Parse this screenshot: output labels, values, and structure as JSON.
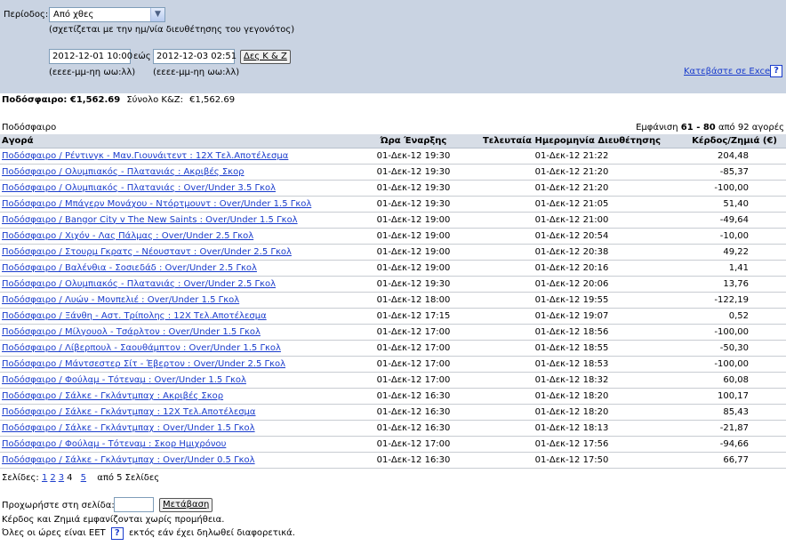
{
  "filters": {
    "period_label": "Περίοδος:",
    "period_value": "Από χθες",
    "period_note": "(σχετίζεται με την ημ/νία διευθέτησης του γεγονότος)",
    "from_value": "2012-12-01 10:00",
    "to_label": "εώς",
    "to_value": "2012-12-03 02:51",
    "show_button": "Δες Κ & Ζ",
    "format_hint_from": "(εεεε-μμ-ηη ωω:λλ)",
    "format_hint_to": "(εεεε-μμ-ηη ωω:λλ)",
    "excel_link": "Κατεβάστε σε Excel",
    "help": "?"
  },
  "totals": {
    "sport_label": "Ποδόσφαιρο: €1,562.69",
    "total_label": "Σύνολο Κ&Ζ:",
    "total_value": "€1,562.69"
  },
  "section_label": "Ποδόσφαιρο",
  "showing": {
    "prefix": "Εμφάνιση",
    "range": "61 - 80",
    "suffix": "από 92 αγορές"
  },
  "columns": [
    "Αγορά",
    "Ώρα Έναρξης",
    "Τελευταία Ημερομηνία Διευθέτησης",
    "Κέρδος/Ζημιά (€)"
  ],
  "rows": [
    {
      "market": "Ποδόσφαιρο / Ρέντινγκ - Μαν.Γιουνάιτεντ : 12X Τελ.Αποτέλεσμα",
      "start": "01-Δεκ-12 19:30",
      "settled": "01-Δεκ-12 21:22",
      "pl": "204,48"
    },
    {
      "market": "Ποδόσφαιρο / Ολυμπιακός - Πλατανιάς : Ακριβές Σκορ",
      "start": "01-Δεκ-12 19:30",
      "settled": "01-Δεκ-12 21:20",
      "pl": "-85,37"
    },
    {
      "market": "Ποδόσφαιρο / Ολυμπιακός - Πλατανιάς : Over/Under 3.5 Γκολ",
      "start": "01-Δεκ-12 19:30",
      "settled": "01-Δεκ-12 21:20",
      "pl": "-100,00"
    },
    {
      "market": "Ποδόσφαιρο / Μπάγερν Μονάχου - Ντόρτμουντ : Over/Under 1.5 Γκολ",
      "start": "01-Δεκ-12 19:30",
      "settled": "01-Δεκ-12 21:05",
      "pl": "51,40"
    },
    {
      "market": "Ποδόσφαιρο / Bangor City v The New Saints : Over/Under 1.5 Γκολ",
      "start": "01-Δεκ-12 19:00",
      "settled": "01-Δεκ-12 21:00",
      "pl": "-49,64"
    },
    {
      "market": "Ποδόσφαιρο / Χιχόν - Λας Πάλμας : Over/Under 2.5 Γκολ",
      "start": "01-Δεκ-12 19:00",
      "settled": "01-Δεκ-12 20:54",
      "pl": "-10,00"
    },
    {
      "market": "Ποδόσφαιρο / Στουρμ Γκρατς - Νέουσταντ : Over/Under 2.5 Γκολ",
      "start": "01-Δεκ-12 19:00",
      "settled": "01-Δεκ-12 20:38",
      "pl": "49,22"
    },
    {
      "market": "Ποδόσφαιρο / Βαλένθια - Σοσιεδάδ : Over/Under 2.5 Γκολ",
      "start": "01-Δεκ-12 19:00",
      "settled": "01-Δεκ-12 20:16",
      "pl": "1,41"
    },
    {
      "market": "Ποδόσφαιρο / Ολυμπιακός - Πλατανιάς : Over/Under 2.5 Γκολ",
      "start": "01-Δεκ-12 19:30",
      "settled": "01-Δεκ-12 20:06",
      "pl": "13,76"
    },
    {
      "market": "Ποδόσφαιρο / Λυών - Μονπελιέ : Over/Under 1.5 Γκολ",
      "start": "01-Δεκ-12 18:00",
      "settled": "01-Δεκ-12 19:55",
      "pl": "-122,19"
    },
    {
      "market": "Ποδόσφαιρο / Ξάνθη - Αστ. Τρίπολης : 12X Τελ.Αποτέλεσμα",
      "start": "01-Δεκ-12 17:15",
      "settled": "01-Δεκ-12 19:07",
      "pl": "0,52"
    },
    {
      "market": "Ποδόσφαιρο / Μίλγουολ - Τσάρλτον : Over/Under 1.5 Γκολ",
      "start": "01-Δεκ-12 17:00",
      "settled": "01-Δεκ-12 18:56",
      "pl": "-100,00"
    },
    {
      "market": "Ποδόσφαιρο / Λίβερπουλ - Σαουθάμπτον : Over/Under 1.5 Γκολ",
      "start": "01-Δεκ-12 17:00",
      "settled": "01-Δεκ-12 18:55",
      "pl": "-50,30"
    },
    {
      "market": "Ποδόσφαιρο / Μάντσεστερ Σίτ - Έβερτον : Over/Under 2.5 Γκολ",
      "start": "01-Δεκ-12 17:00",
      "settled": "01-Δεκ-12 18:53",
      "pl": "-100,00"
    },
    {
      "market": "Ποδόσφαιρο / Φούλαμ - Τότεναμ : Over/Under 1.5 Γκολ",
      "start": "01-Δεκ-12 17:00",
      "settled": "01-Δεκ-12 18:32",
      "pl": "60,08"
    },
    {
      "market": "Ποδόσφαιρο / Σάλκε - Γκλάντμπαχ : Ακριβές Σκορ",
      "start": "01-Δεκ-12 16:30",
      "settled": "01-Δεκ-12 18:20",
      "pl": "100,17"
    },
    {
      "market": "Ποδόσφαιρο / Σάλκε - Γκλάντμπαχ : 12X Τελ.Αποτέλεσμα",
      "start": "01-Δεκ-12 16:30",
      "settled": "01-Δεκ-12 18:20",
      "pl": "85,43"
    },
    {
      "market": "Ποδόσφαιρο / Σάλκε - Γκλάντμπαχ : Over/Under 1.5 Γκολ",
      "start": "01-Δεκ-12 16:30",
      "settled": "01-Δεκ-12 18:13",
      "pl": "-21,87"
    },
    {
      "market": "Ποδόσφαιρο / Φούλαμ - Τότεναμ : Σκορ Ημιχρόνου",
      "start": "01-Δεκ-12 17:00",
      "settled": "01-Δεκ-12 17:56",
      "pl": "-94,66"
    },
    {
      "market": "Ποδόσφαιρο / Σάλκε - Γκλάντμπαχ : Over/Under 0.5 Γκολ",
      "start": "01-Δεκ-12 16:30",
      "settled": "01-Δεκ-12 17:50",
      "pl": "66,77"
    }
  ],
  "pager": {
    "label": "Σελίδες:",
    "pages": [
      "1",
      "2",
      "3"
    ],
    "current": "4",
    "next_page": "5",
    "suffix": "από 5 Σελίδες"
  },
  "goto": {
    "label": "Προχωρήστε στη σελίδα:",
    "value": "",
    "button": "Μετάβαση"
  },
  "notes": {
    "commission": "Κέρδος και Ζημιά εμφανίζονται χωρίς προμήθεια.",
    "tz_prefix": "Όλες οι ώρες είναι EET",
    "tz_help": "?",
    "tz_suffix": "εκτός εάν έχει δηλωθεί διαφορετικά."
  },
  "colors": {
    "panel": "#c9d3e2",
    "header": "#d7dde6",
    "link": "#1a3ccc"
  }
}
